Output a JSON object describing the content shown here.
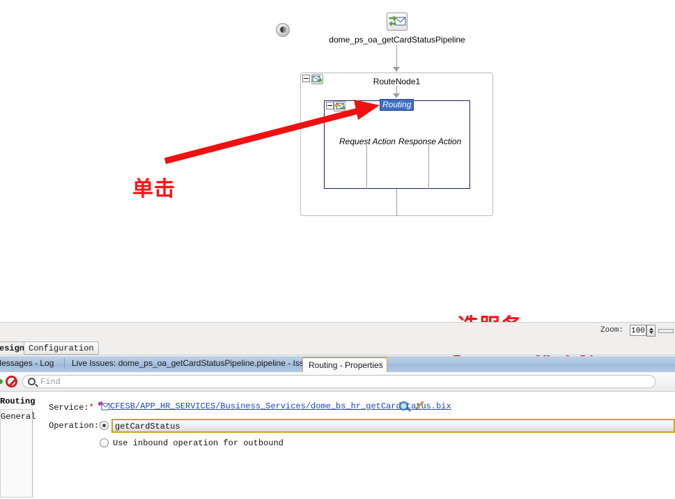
{
  "canvas": {
    "back_button": "back-navigation-button",
    "pipeline_name": "dome_ps_oa_getCardStatusPipeline",
    "route_node_name": "RouteNode1",
    "routing_label": "Routing",
    "request_action_label": "Request Action",
    "response_action_label": "Response Action"
  },
  "annotations": {
    "click": "单击",
    "select_service": "选服务",
    "select_method": "选方法",
    "color": "#ff1010"
  },
  "zoombar": {
    "label": "Zoom:",
    "value": "100"
  },
  "editor_tabs": [
    {
      "label": "esign",
      "selected": true
    },
    {
      "label": "Configuration",
      "selected": false
    }
  ],
  "log_tabs": [
    {
      "label": "Messages - Log",
      "active": false
    },
    {
      "label": "Live Issues: dome_ps_oa_getCardStatusPipeline.pipeline - Issues",
      "active": false
    }
  ],
  "active_log_tab": {
    "label": "Routing - Properties",
    "close": "×"
  },
  "find_bar": {
    "placeholder": "Find",
    "value": ""
  },
  "properties": {
    "title": "Routing",
    "sidebar_item": "General",
    "service": {
      "label": "Service:",
      "required": "*",
      "value": "CFESB/APP_HR_SERVICES/Business_Services/dome_bs_hr_getCardStatus.bix",
      "browse_icon": "search-icon",
      "edit_icon": "pencil-icon"
    },
    "operation": {
      "label": "Operation:",
      "required": "*",
      "value": "getCardStatus",
      "selected": true
    },
    "use_inbound": {
      "label": "Use inbound operation for outbound",
      "selected": false
    }
  }
}
